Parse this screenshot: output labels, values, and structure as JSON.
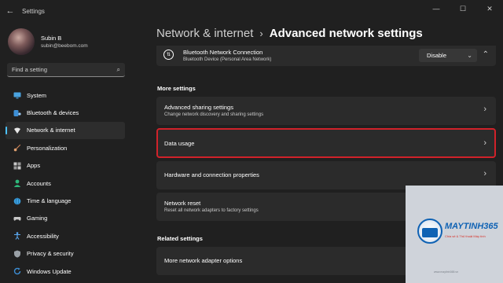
{
  "window": {
    "title": "Settings",
    "back_glyph": "←",
    "minimize_glyph": "—",
    "maximize_glyph": "☐",
    "close_glyph": "✕"
  },
  "profile": {
    "name": "Subin B",
    "email": "subin@beebom.com"
  },
  "search": {
    "placeholder": "Find a setting",
    "icon": "search-icon"
  },
  "sidebar": {
    "items": [
      {
        "label": "System",
        "icon": "display-icon",
        "color": "#4aa3e0"
      },
      {
        "label": "Bluetooth & devices",
        "icon": "bluetooth-icon",
        "color": "#3d8fd6"
      },
      {
        "label": "Network & internet",
        "icon": "wifi-icon",
        "color": "#e8e8e8",
        "active": true
      },
      {
        "label": "Personalization",
        "icon": "brush-icon",
        "color": "#d9895a"
      },
      {
        "label": "Apps",
        "icon": "apps-icon",
        "color": "#c8c8c8"
      },
      {
        "label": "Accounts",
        "icon": "person-icon",
        "color": "#2eb87a"
      },
      {
        "label": "Time & language",
        "icon": "globe-icon",
        "color": "#3aa0e0"
      },
      {
        "label": "Gaming",
        "icon": "controller-icon",
        "color": "#c8c8c8"
      },
      {
        "label": "Accessibility",
        "icon": "accessibility-icon",
        "color": "#5aa8f0"
      },
      {
        "label": "Privacy & security",
        "icon": "shield-icon",
        "color": "#9aa0a6"
      },
      {
        "label": "Windows Update",
        "icon": "update-icon",
        "color": "#3d8fd6"
      }
    ]
  },
  "breadcrumb": {
    "parent": "Network & internet",
    "separator": "›",
    "current": "Advanced network settings"
  },
  "bluetooth_connection": {
    "title": "Bluetooth Network Connection",
    "subtitle": "Bluetooth Device (Personal Area Network)",
    "button": "Disable",
    "dropdown_glyph": "⌄",
    "more_glyph": "⌃"
  },
  "more_settings": {
    "header": "More settings",
    "chevron": "›",
    "items": [
      {
        "title": "Advanced sharing settings",
        "subtitle": "Change network discovery and sharing settings"
      },
      {
        "title": "Data usage",
        "subtitle": "",
        "highlighted": true
      },
      {
        "title": "Hardware and connection properties",
        "subtitle": ""
      },
      {
        "title": "Network reset",
        "subtitle": "Reset all network adapters to factory settings"
      }
    ]
  },
  "related_settings": {
    "header": "Related settings",
    "items": [
      {
        "title": "More network adapter options"
      }
    ]
  },
  "watermark": {
    "brand": "MAYTINH365",
    "tagline": "Chia sẻ & Thủ thuật Máy tính",
    "url": "www.maytinh365.vn"
  },
  "colors": {
    "background": "#202020",
    "card": "#2b2b2b",
    "accent": "#4cc2ff",
    "highlight_border": "#d0222a",
    "watermark_blue": "#0f62b4"
  }
}
